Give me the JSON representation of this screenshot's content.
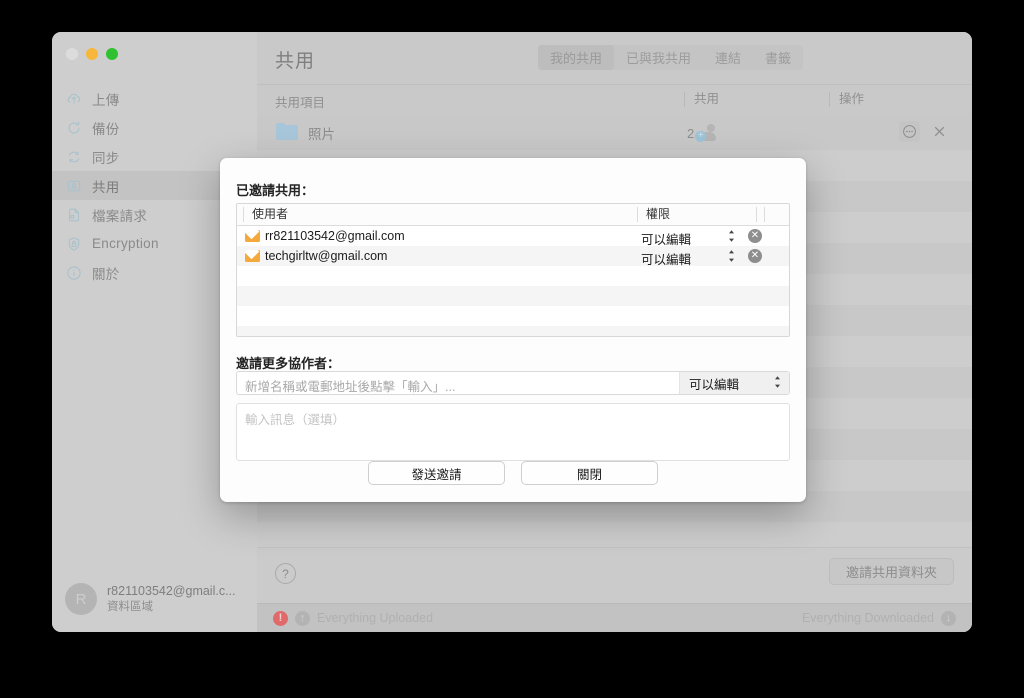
{
  "window": {
    "traffic_lights": [
      "close",
      "minimize",
      "maximize"
    ]
  },
  "sidebar": {
    "items": [
      {
        "label": "上傳",
        "icon": "upload-cloud-icon",
        "active": false
      },
      {
        "label": "備份",
        "icon": "backup-icon",
        "active": false
      },
      {
        "label": "同步",
        "icon": "sync-icon",
        "active": false
      },
      {
        "label": "共用",
        "icon": "share-icon",
        "active": true
      },
      {
        "label": "檔案請求",
        "icon": "file-request-icon",
        "active": false
      },
      {
        "label": "Encryption",
        "icon": "lock-shield-icon",
        "active": false
      },
      {
        "label": "關於",
        "icon": "info-icon",
        "active": false
      }
    ],
    "account": {
      "avatar_initial": "R",
      "email": "r821103542@gmail.c...",
      "region": "資料區域"
    }
  },
  "header": {
    "title": "共用",
    "tabs": [
      {
        "label": "我的共用",
        "selected": true
      },
      {
        "label": "已與我共用",
        "selected": false
      },
      {
        "label": "連結",
        "selected": false
      },
      {
        "label": "書籤",
        "selected": false
      }
    ]
  },
  "list": {
    "columns": [
      "共用項目",
      "共用",
      "操作"
    ],
    "rows": [
      {
        "name": "照片",
        "icon": "folder-icon",
        "share_count": "2",
        "actions": [
          "more-icon",
          "close-icon"
        ]
      }
    ]
  },
  "footer": {
    "help_label": "?",
    "invite_folder_label": "邀請共用資料夾"
  },
  "status": {
    "upload_text": "Everything Uploaded",
    "download_text": "Everything Downloaded",
    "alert_glyph": "!",
    "upload_glyph": "↑",
    "download_glyph": "↓"
  },
  "modal": {
    "invited_label": "已邀請共用：",
    "table": {
      "headers": [
        "使用者",
        "權限",
        "",
        ""
      ],
      "rows": [
        {
          "email": "rr821103542@gmail.com",
          "permission": "可以編輯",
          "icon": "mail-icon",
          "remove_glyph": "✕"
        },
        {
          "email": "techgirltw@gmail.com",
          "permission": "可以編輯",
          "icon": "mail-icon",
          "remove_glyph": "✕"
        }
      ],
      "empty_rows": 4
    },
    "invite_more_label": "邀請更多協作者：",
    "invite_input_placeholder": "新增名稱或電郵地址後點擊「輸入」...",
    "invite_input_value": "",
    "invite_permission": "可以編輯",
    "message_placeholder": "輸入訊息（選填）",
    "message_value": "",
    "buttons": {
      "send": "發送邀請",
      "close": "關閉"
    }
  },
  "colors": {
    "accent_blue": "#a7c6da",
    "mail_orange": "#f5a83c",
    "alert_red": "#e06a6a",
    "window_bg": "#c9c9c9",
    "modal_bg": "#fdfdfd"
  }
}
